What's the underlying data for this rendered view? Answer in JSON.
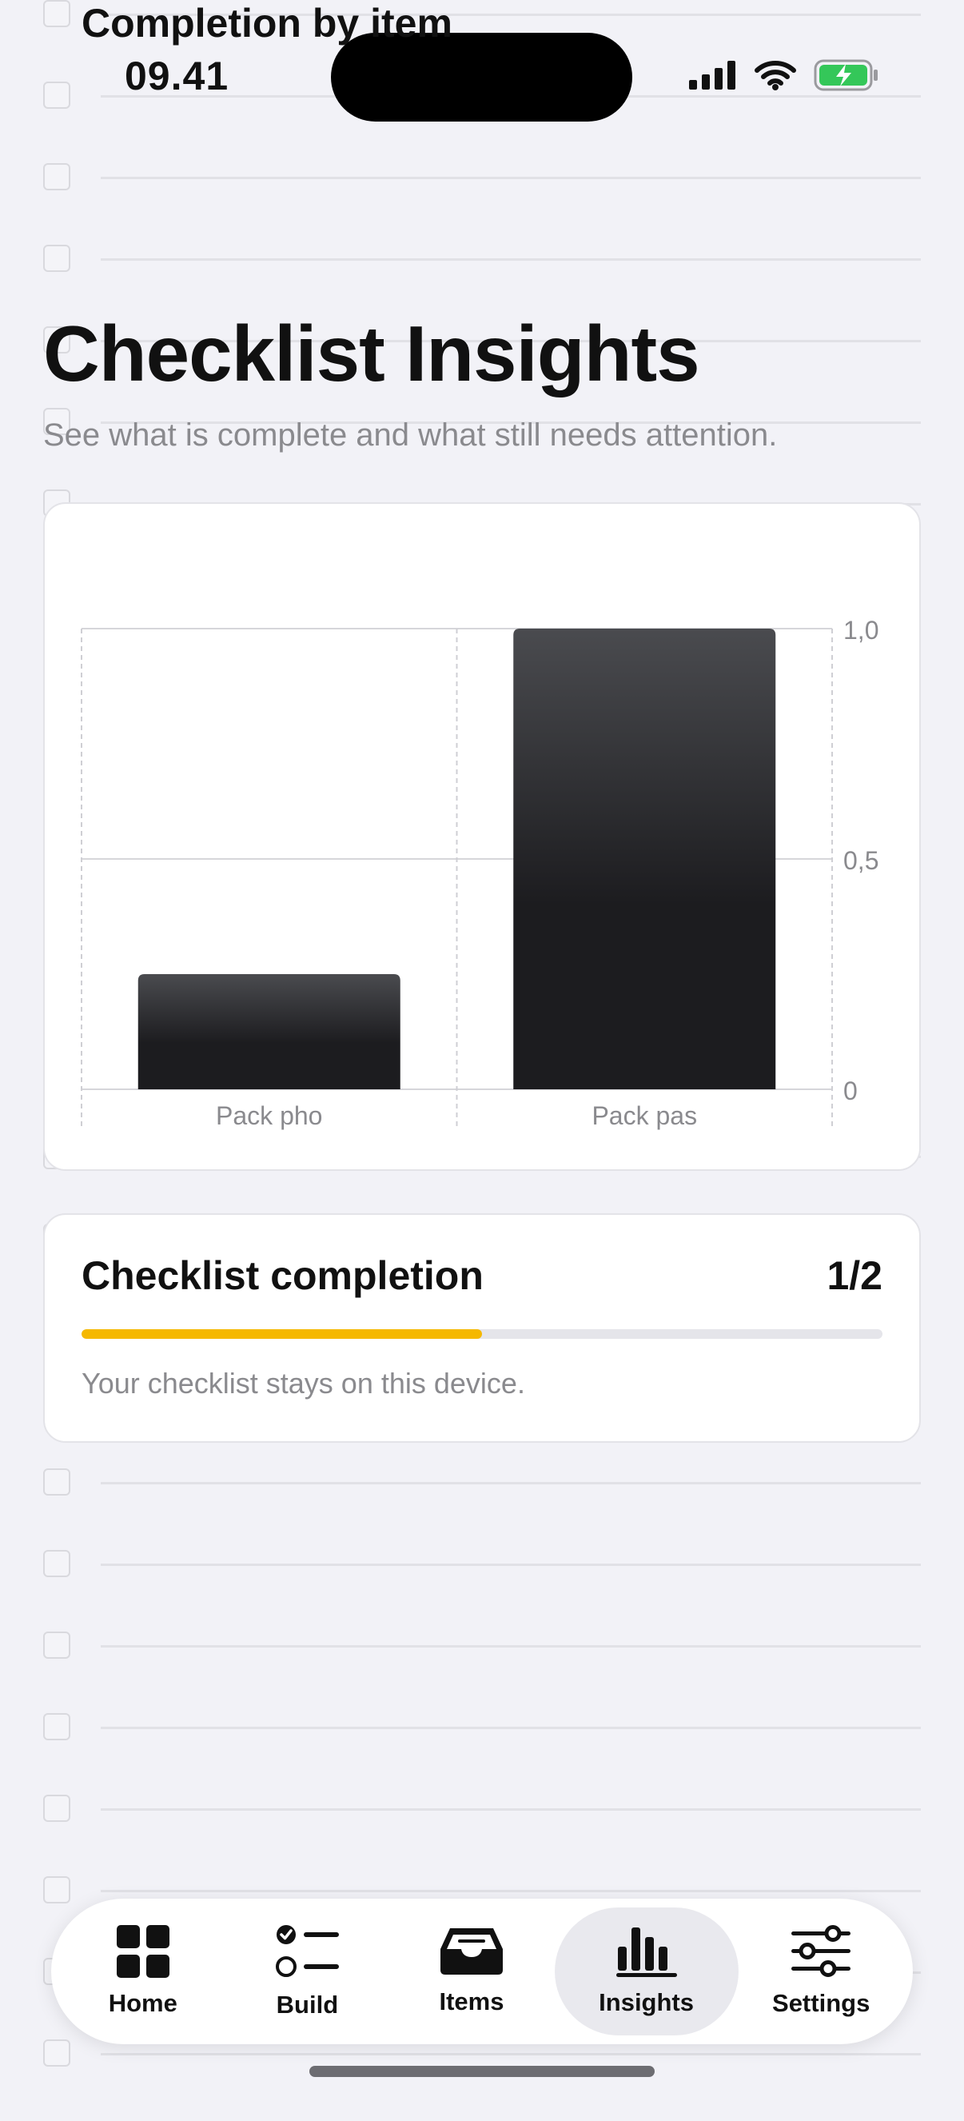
{
  "status_bar": {
    "time": "09.41"
  },
  "header": {
    "title": "Checklist Insights",
    "subtitle": "See what is complete and what still needs attention."
  },
  "completion_card": {
    "title": "Completion by item"
  },
  "chart_data": {
    "type": "bar",
    "title": "Completion by item",
    "categories": [
      "Pack pho",
      "Pack pas"
    ],
    "values": [
      0.25,
      1.0
    ],
    "ylim": [
      0,
      1
    ],
    "yticks": [
      "0",
      "0,5",
      "1,0"
    ],
    "y_axis_side": "right",
    "grid": true,
    "bar_color": "#1c1c1f"
  },
  "progress_card": {
    "title": "Checklist completion",
    "count": "1/2",
    "progress": 0.5,
    "note": "Your checklist stays on this device.",
    "accent": "#f5b800"
  },
  "tab_bar": {
    "tabs": [
      {
        "label": "Home",
        "icon": "grid-icon"
      },
      {
        "label": "Build",
        "icon": "checklist-icon"
      },
      {
        "label": "Items",
        "icon": "tray-icon"
      },
      {
        "label": "Insights",
        "icon": "bar-chart-icon",
        "active": true
      },
      {
        "label": "Settings",
        "icon": "sliders-icon"
      }
    ]
  }
}
